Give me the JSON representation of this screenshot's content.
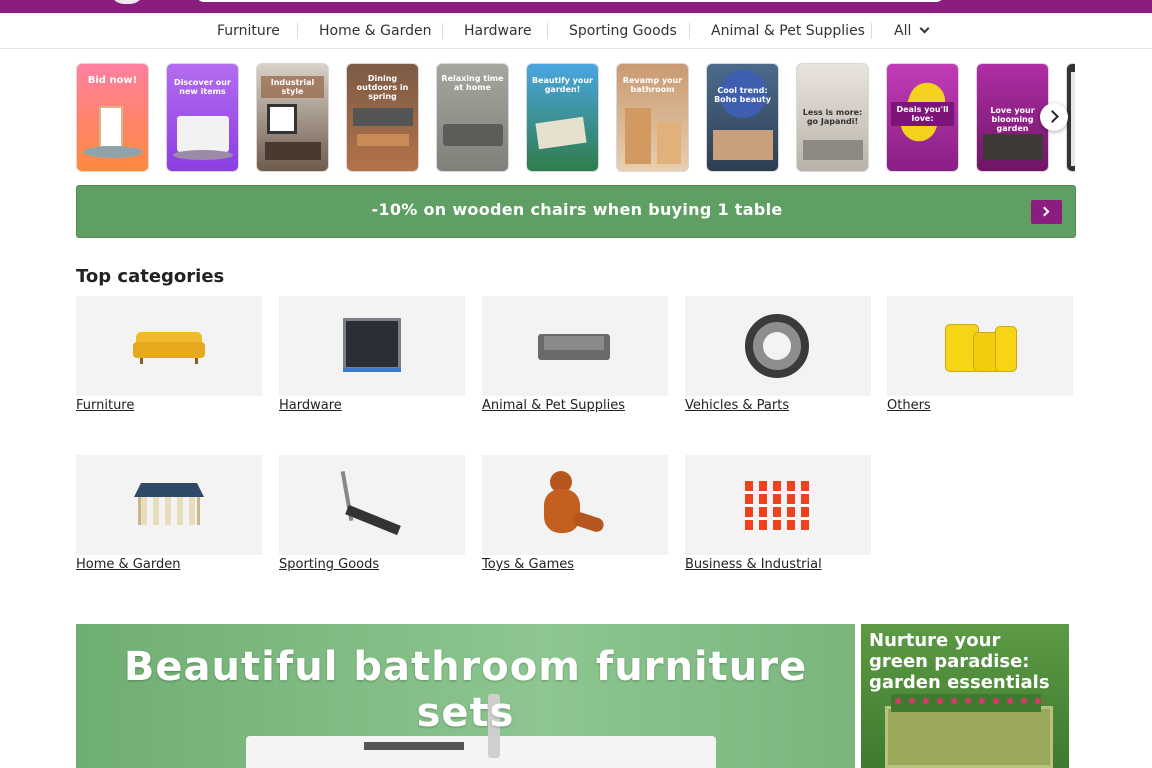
{
  "nav": {
    "items": [
      "Furniture",
      "Home & Garden",
      "Hardware",
      "Sporting Goods",
      "Animal & Pet Supplies"
    ],
    "all_label": "All"
  },
  "stories": [
    {
      "caption": "Bid now!",
      "bg": "#ff8a5b"
    },
    {
      "caption": "Discover our new items",
      "bg": "#a052e8"
    },
    {
      "caption": "Industrial style",
      "bg": "#7a6b5e"
    },
    {
      "caption": "Dining outdoors in spring",
      "bg": "#8a5a3c"
    },
    {
      "caption": "Relaxing time at home",
      "bg": "#8a8a84"
    },
    {
      "caption": "Beautify your garden!",
      "bg": "#3e9bd6"
    },
    {
      "caption": "Revamp your bathroom",
      "bg": "#c7895d"
    },
    {
      "caption": "Cool trend: Boho beauty",
      "bg": "#3f5a7a"
    },
    {
      "caption": "Less is more: go Japandi!",
      "bg": "#cfcac3"
    },
    {
      "caption": "Deals you'll love:",
      "bg": "#c230b8"
    },
    {
      "caption": "Love your blooming garden",
      "bg": "#8b1d7e"
    },
    {
      "caption": "",
      "bg": "#333333"
    }
  ],
  "promo": {
    "text": "-10% on wooden chairs when buying 1 table"
  },
  "top_categories": {
    "title": "Top categories",
    "items": [
      "Furniture",
      "Hardware",
      "Animal & Pet Supplies",
      "Vehicles & Parts",
      "Others",
      "Home & Garden",
      "Sporting Goods",
      "Toys & Games",
      "Business & Industrial"
    ]
  },
  "banners": {
    "main": "Beautiful bathroom furniture sets",
    "side": "Nurture your green paradise: garden essentials"
  },
  "colors": {
    "brand": "#8b1d7e",
    "promo_green": "#5f9f63"
  }
}
